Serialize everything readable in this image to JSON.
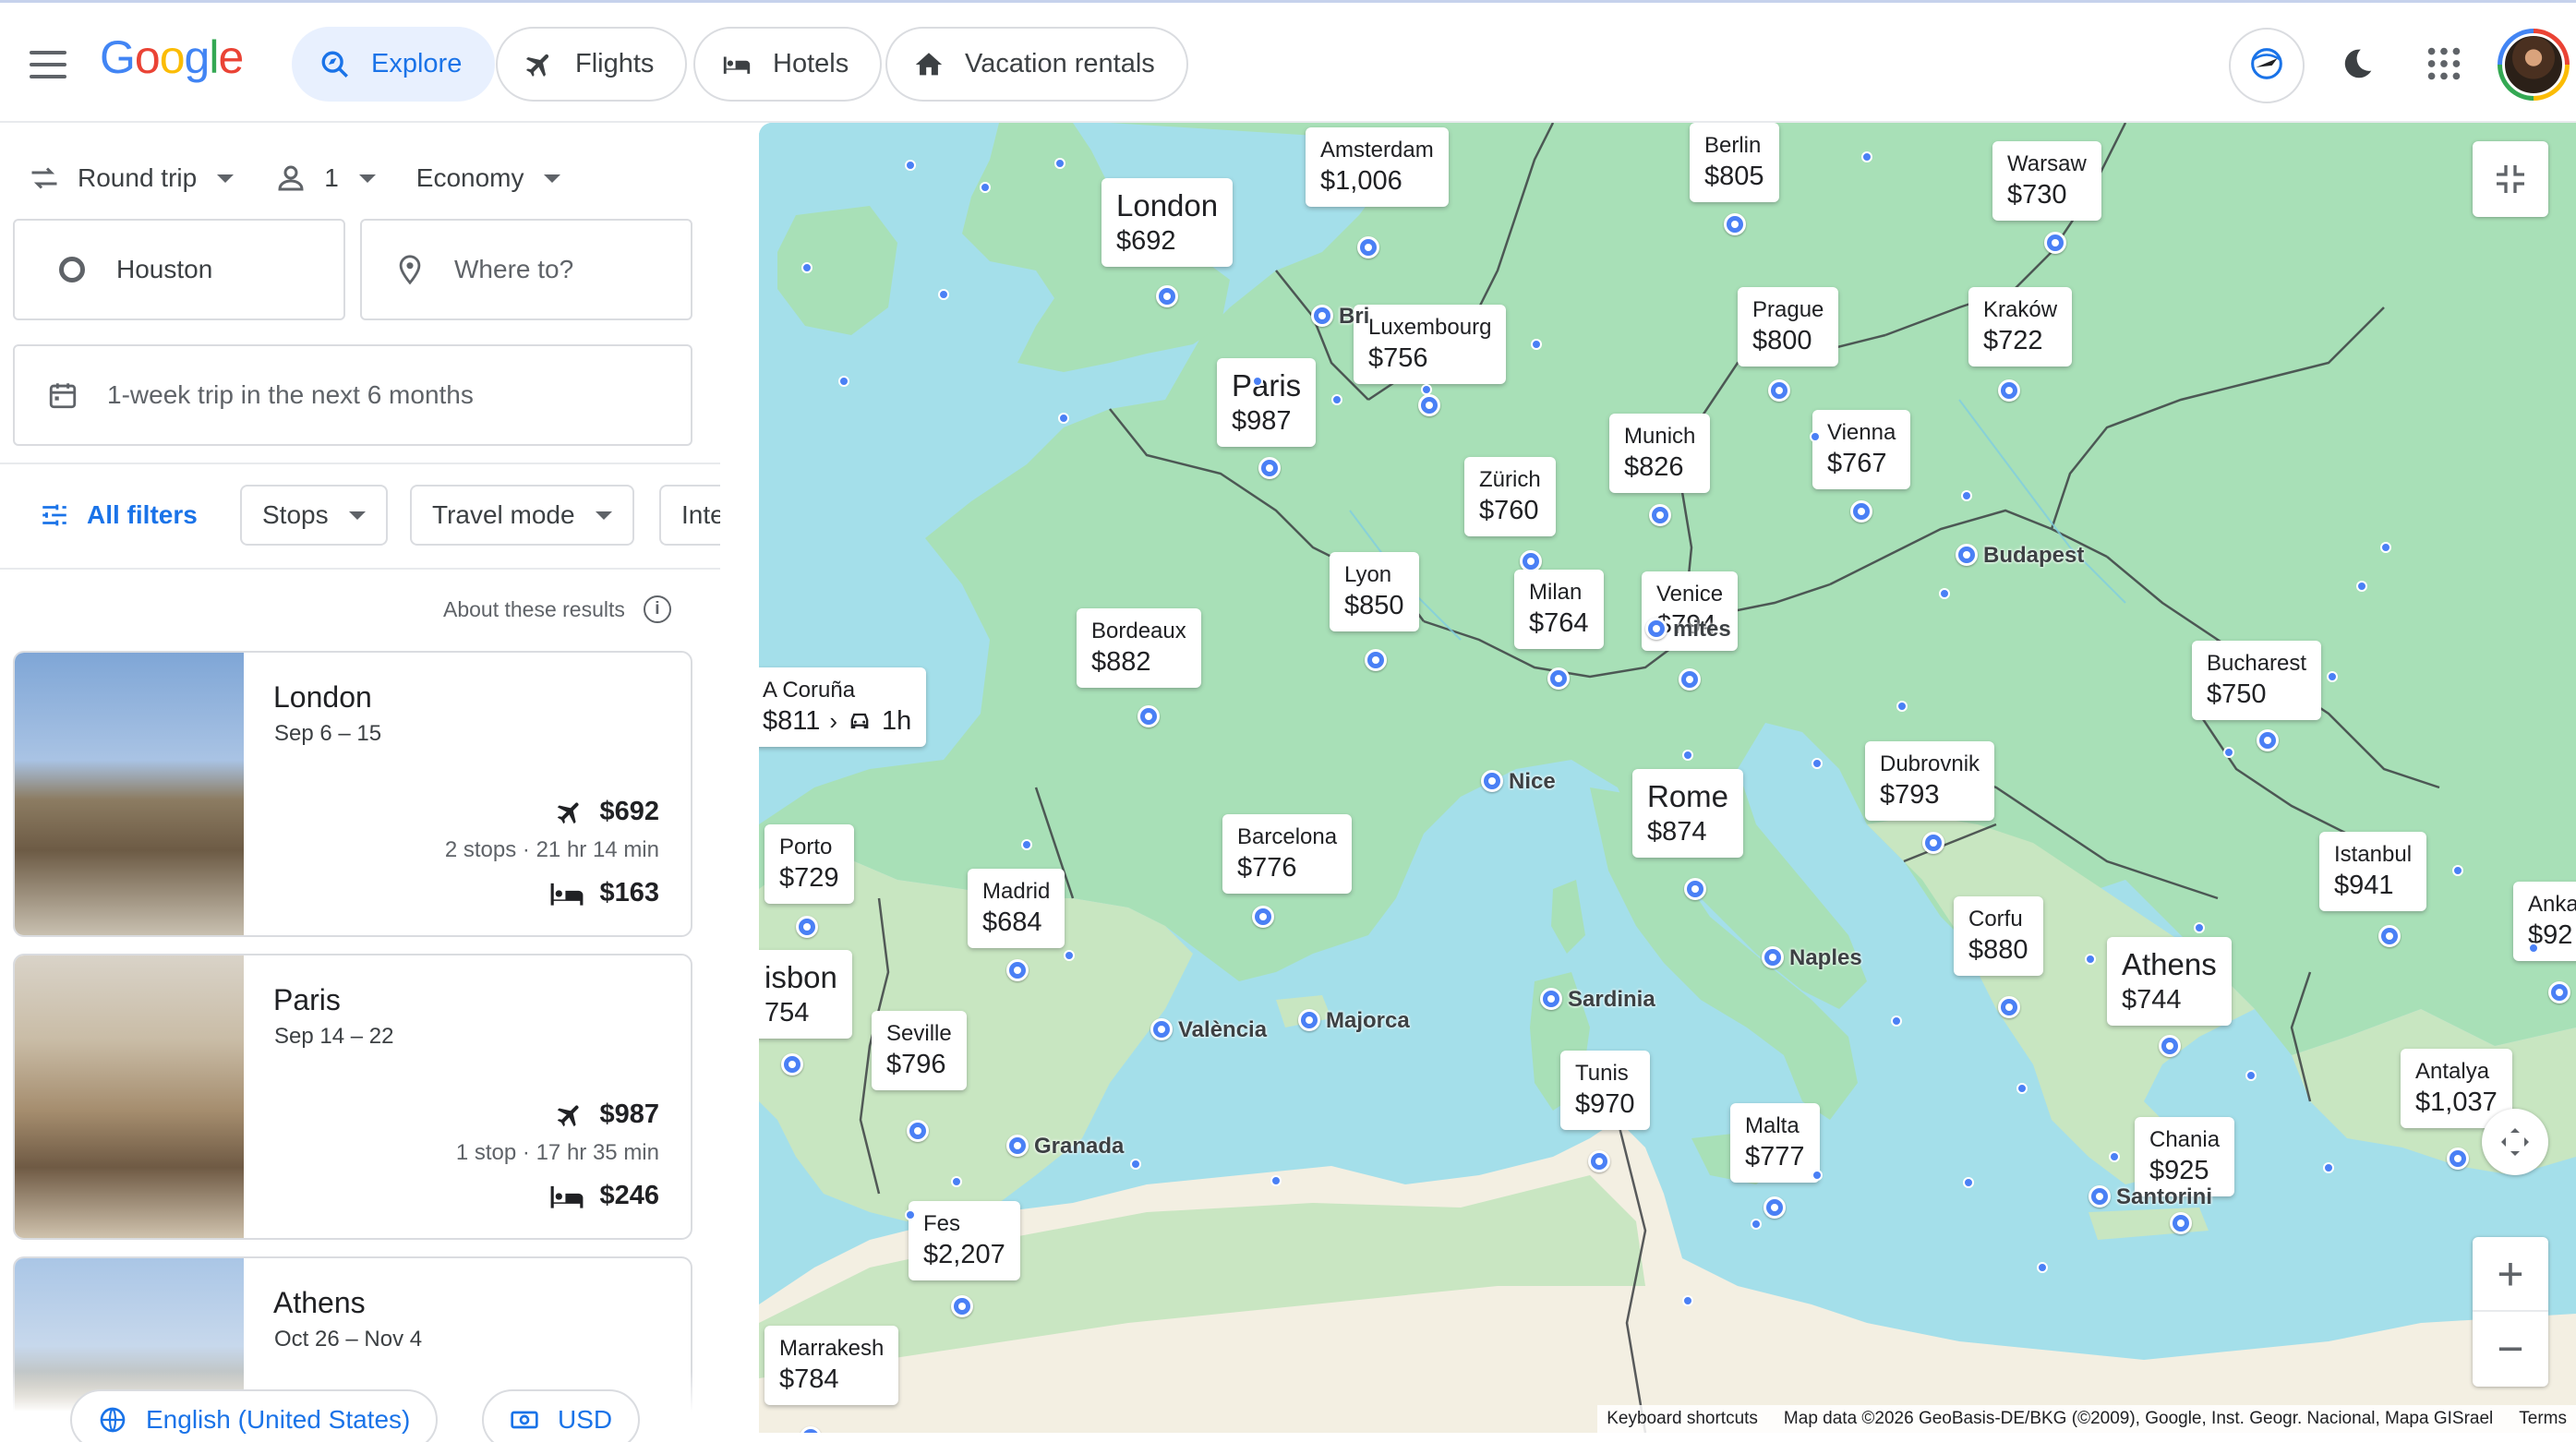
{
  "header": {
    "logo": "Google",
    "nav": [
      {
        "label": "Explore",
        "active": true
      },
      {
        "label": "Flights"
      },
      {
        "label": "Hotels"
      },
      {
        "label": "Vacation rentals"
      }
    ]
  },
  "search": {
    "trip_type": "Round trip",
    "passengers": "1",
    "cabin": "Economy",
    "origin": "Houston",
    "destination_placeholder": "Where to?",
    "dates": "1-week trip in the next 6 months"
  },
  "filters": {
    "all": "All filters",
    "stops": "Stops",
    "travel_mode": "Travel mode",
    "interests": "Inte"
  },
  "about": "About these results",
  "results": [
    {
      "city": "London",
      "dates": "Sep 6 – 15",
      "flight_price": "$692",
      "flight_details": "2 stops · 21 hr 14 min",
      "hotel_price": "$163"
    },
    {
      "city": "Paris",
      "dates": "Sep 14 – 22",
      "flight_price": "$987",
      "flight_details": "1 stop · 17 hr 35 min",
      "hotel_price": "$246"
    },
    {
      "city": "Athens",
      "dates": "Oct 26 – Nov 4"
    }
  ],
  "footer": {
    "language": "English (United States)",
    "currency": "USD"
  },
  "map": {
    "destinations": [
      {
        "city": "Amsterdam",
        "price": "$1,006"
      },
      {
        "city": "Berlin",
        "price": "$805"
      },
      {
        "city": "Warsaw",
        "price": "$730"
      },
      {
        "city": "London",
        "price": "$692"
      },
      {
        "city": "Luxembourg",
        "price": "$756"
      },
      {
        "city": "Prague",
        "price": "$800"
      },
      {
        "city": "Kraków",
        "price": "$722"
      },
      {
        "city": "Paris",
        "price": "$987"
      },
      {
        "city": "Munich",
        "price": "$826"
      },
      {
        "city": "Vienna",
        "price": "$767"
      },
      {
        "city": "Zürich",
        "price": "$760"
      },
      {
        "city": "Lyon",
        "price": "$850"
      },
      {
        "city": "Milan",
        "price": "$764"
      },
      {
        "city": "Venice",
        "price": "$794"
      },
      {
        "city": "Bordeaux",
        "price": "$882"
      },
      {
        "city": "Bucharest",
        "price": "$750"
      },
      {
        "city": "Dubrovnik",
        "price": "$793"
      },
      {
        "city": "Rome",
        "price": "$874"
      },
      {
        "city": "Porto",
        "price": "$729"
      },
      {
        "city": "Barcelona",
        "price": "$776"
      },
      {
        "city": "Madrid",
        "price": "$684"
      },
      {
        "city": "Istanbul",
        "price": "$941"
      },
      {
        "city": "Corfu",
        "price": "$880"
      },
      {
        "city": "Athens",
        "price": "$744"
      },
      {
        "city": "Seville",
        "price": "$796"
      },
      {
        "city": "Tunis",
        "price": "$970"
      },
      {
        "city": "Malta",
        "price": "$777"
      },
      {
        "city": "Antalya",
        "price": "$1,037"
      },
      {
        "city": "Chania",
        "price": "$925"
      },
      {
        "city": "Fes",
        "price": "$2,207"
      },
      {
        "city": "Marrakesh",
        "price": "$784"
      },
      {
        "city": "Anka",
        "price": "$92"
      },
      {
        "city": "isbon",
        "price": "754"
      }
    ],
    "coruna": {
      "city": "A Coruña",
      "price": "$811",
      "duration": "1h"
    },
    "places": [
      "Budapest",
      "Nice",
      "Naples",
      "Sardinia",
      "València",
      "Majorca",
      "Granada",
      "Santorini",
      "mites",
      "Bri"
    ],
    "attribution": {
      "shortcuts": "Keyboard shortcuts",
      "data": "Map data ©2026 GeoBasis-DE/BKG (©2009), Google, Inst. Geogr. Nacional, Mapa GISrael",
      "terms": "Terms"
    }
  }
}
